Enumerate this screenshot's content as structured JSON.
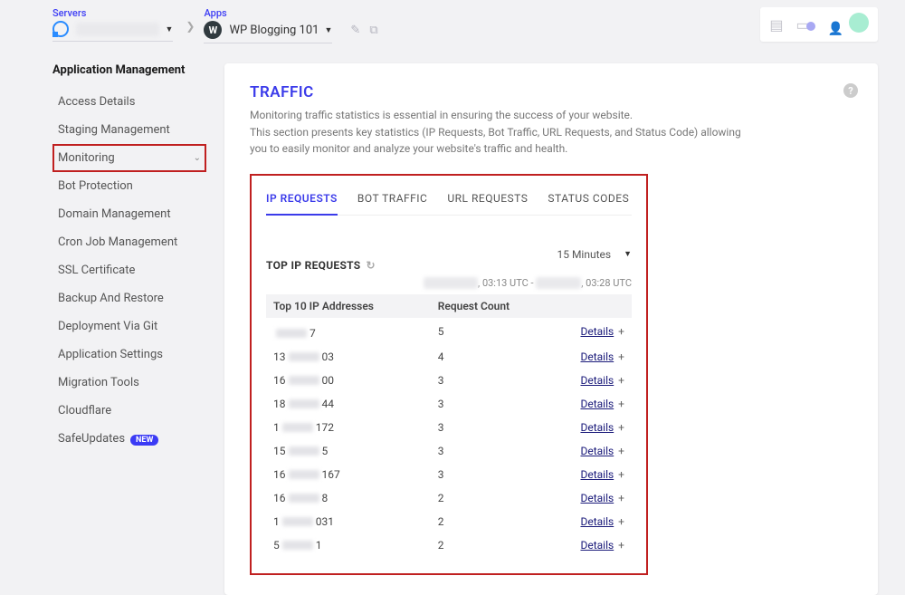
{
  "topbar": {
    "servers_label": "Servers",
    "apps_label": "Apps",
    "app_name": "WP Blogging 101"
  },
  "sidebar": {
    "heading": "Application Management",
    "items": [
      {
        "label": "Access Details"
      },
      {
        "label": "Staging Management"
      },
      {
        "label": "Monitoring"
      },
      {
        "label": "Bot Protection"
      },
      {
        "label": "Domain Management"
      },
      {
        "label": "Cron Job Management"
      },
      {
        "label": "SSL Certificate"
      },
      {
        "label": "Backup And Restore"
      },
      {
        "label": "Deployment Via Git"
      },
      {
        "label": "Application Settings"
      },
      {
        "label": "Migration Tools"
      },
      {
        "label": "Cloudflare"
      },
      {
        "label": "SafeUpdates"
      }
    ],
    "new_badge": "NEW"
  },
  "panel": {
    "title": "TRAFFIC",
    "desc1": "Monitoring traffic statistics is essential in ensuring the success of your website.",
    "desc2": "This section presents key statistics (IP Requests, Bot Traffic, URL Requests, and Status Code) allowing you to easily monitor and analyze your website's traffic and health.",
    "tabs": [
      "IP REQUESTS",
      "BOT TRAFFIC",
      "URL REQUESTS",
      "STATUS CODES"
    ],
    "section_title": "TOP IP REQUESTS",
    "time_range": "15 Minutes",
    "ts_mid": ", 03:13 UTC - ",
    "ts_end": ", 03:28 UTC",
    "col1": "Top 10 IP Addresses",
    "col2": "Request Count",
    "details_label": "Details",
    "rows": [
      {
        "ip_prefix": "",
        "ip_suffix": "7",
        "count": "5"
      },
      {
        "ip_prefix": "13",
        "ip_suffix": "03",
        "count": "4"
      },
      {
        "ip_prefix": "16",
        "ip_suffix": "00",
        "count": "3"
      },
      {
        "ip_prefix": "18",
        "ip_suffix": "44",
        "count": "3"
      },
      {
        "ip_prefix": "1",
        "ip_suffix": "172",
        "count": "3"
      },
      {
        "ip_prefix": "15",
        "ip_suffix": "5",
        "count": "3"
      },
      {
        "ip_prefix": "16",
        "ip_suffix": "167",
        "count": "3"
      },
      {
        "ip_prefix": "16",
        "ip_suffix": "8",
        "count": "2"
      },
      {
        "ip_prefix": "1",
        "ip_suffix": "031",
        "count": "2"
      },
      {
        "ip_prefix": "5",
        "ip_suffix": "1",
        "count": "2"
      }
    ]
  }
}
